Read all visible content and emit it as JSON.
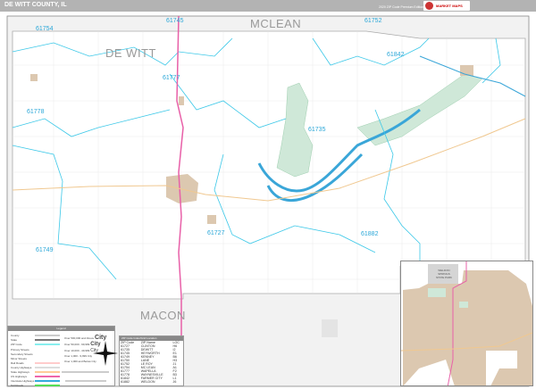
{
  "header": {
    "title": "DE WITT COUNTY, IL",
    "edition": "2020 ZIP Code Premium Edition",
    "logo_text": "MARKET MAPS"
  },
  "colors": {
    "header": "#b3b3b3",
    "zip_boundary": "#3cc8e8",
    "water": "#3aa6d8",
    "park": "#cfe8d8",
    "urban": "#dcc8b0",
    "interstate": "#e860a8",
    "highway": "#f0c890",
    "neighbor": "#f0f0f0"
  },
  "map": {
    "counties": {
      "main": "DE WITT",
      "north": "MCLEAN",
      "south": "MACON"
    },
    "zip_labels": [
      "61754",
      "61745",
      "61752",
      "61842",
      "61777",
      "61778",
      "61735",
      "61727",
      "61749",
      "61882"
    ]
  },
  "legend": {
    "title": "Legend",
    "items": [
      "County",
      "State",
      "ZIP Code",
      "Primary Streets",
      "Secondary Streets",
      "Minor Streets",
      "Rail Roads",
      "County Highways",
      "State Highways",
      "US Highways",
      "Interstate Highways",
      "Toll Roads"
    ],
    "city_classes": [
      {
        "range": "Over 500,000 and Above",
        "sample": "City"
      },
      {
        "range": "Over 50,000 - 99,999",
        "sample": "City"
      },
      {
        "range": "Over 10,000 - 49,999",
        "sample": "City"
      },
      {
        "range": "Over 1,000 - 9,999",
        "sample": "City"
      },
      {
        "range": "Over 1,000 and Below",
        "sample": "City"
      }
    ]
  },
  "index": {
    "title": "ZIP Code Index/Grid Location",
    "headers": [
      "ZIP Code",
      "ZIP Name",
      "LOC"
    ],
    "rows": [
      [
        "61727",
        "CLINTON",
        "H6"
      ],
      [
        "61735",
        "DEWITT",
        "I2"
      ],
      [
        "61745",
        "HEYWORTH",
        "E1"
      ],
      [
        "61749",
        "KENNEY",
        "B6"
      ],
      [
        "61750",
        "LANE",
        "H3"
      ],
      [
        "61752",
        "LE ROY",
        "J1"
      ],
      [
        "61754",
        "MC LEAN",
        "A1"
      ],
      [
        "61777",
        "WAPELLA",
        "F2"
      ],
      [
        "61778",
        "WAYNESVILLE",
        "B3"
      ],
      [
        "61842",
        "FARMER CITY",
        "L1"
      ],
      [
        "61882",
        "WELDON",
        "J6"
      ]
    ]
  },
  "inset": {
    "label": "WELDON SPRINGS STATE PARK"
  }
}
